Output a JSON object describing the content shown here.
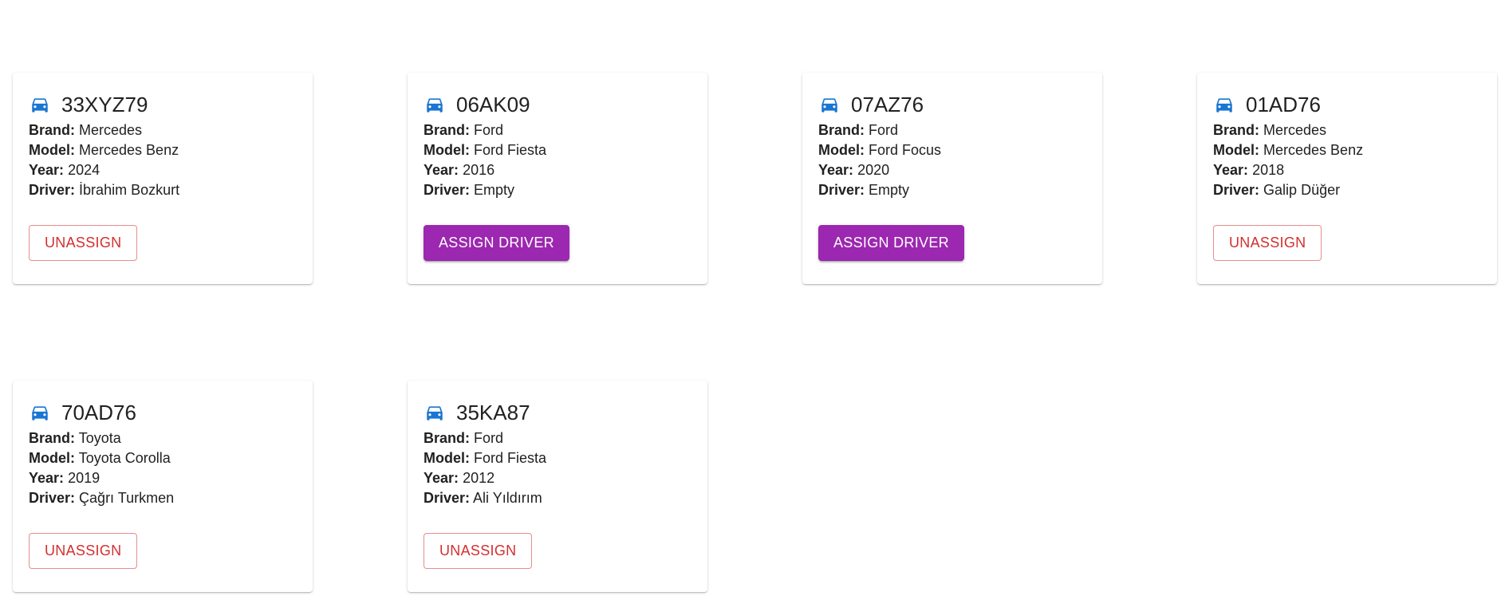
{
  "labels": {
    "brand": "Brand:",
    "model": "Model:",
    "year": "Year:",
    "driver": "Driver:"
  },
  "accent_colors": {
    "icon": "#1976d2",
    "unassign": "#d32f2f",
    "assign": "#9c27b0"
  },
  "vehicles": [
    {
      "plate": "33XYZ79",
      "brand": "Mercedes",
      "model": "Mercedes Benz",
      "year": "2024",
      "driver": "İbrahim Bozkurt",
      "action": "UNASSIGN"
    },
    {
      "plate": "06AK09",
      "brand": "Ford",
      "model": "Ford Fiesta",
      "year": "2016",
      "driver": "Empty",
      "action": "ASSIGN DRIVER"
    },
    {
      "plate": "07AZ76",
      "brand": "Ford",
      "model": "Ford Focus",
      "year": "2020",
      "driver": "Empty",
      "action": "ASSIGN DRIVER"
    },
    {
      "plate": "01AD76",
      "brand": "Mercedes",
      "model": "Mercedes Benz",
      "year": "2018",
      "driver": "Galip Düğer",
      "action": "UNASSIGN"
    },
    {
      "plate": "70AD76",
      "brand": "Toyota",
      "model": "Toyota Corolla",
      "year": "2019",
      "driver": "Çağrı Turkmen",
      "action": "UNASSIGN"
    },
    {
      "plate": "35KA87",
      "brand": "Ford",
      "model": "Ford Fiesta",
      "year": "2012",
      "driver": "Ali Yıldırım",
      "action": "UNASSIGN"
    }
  ]
}
